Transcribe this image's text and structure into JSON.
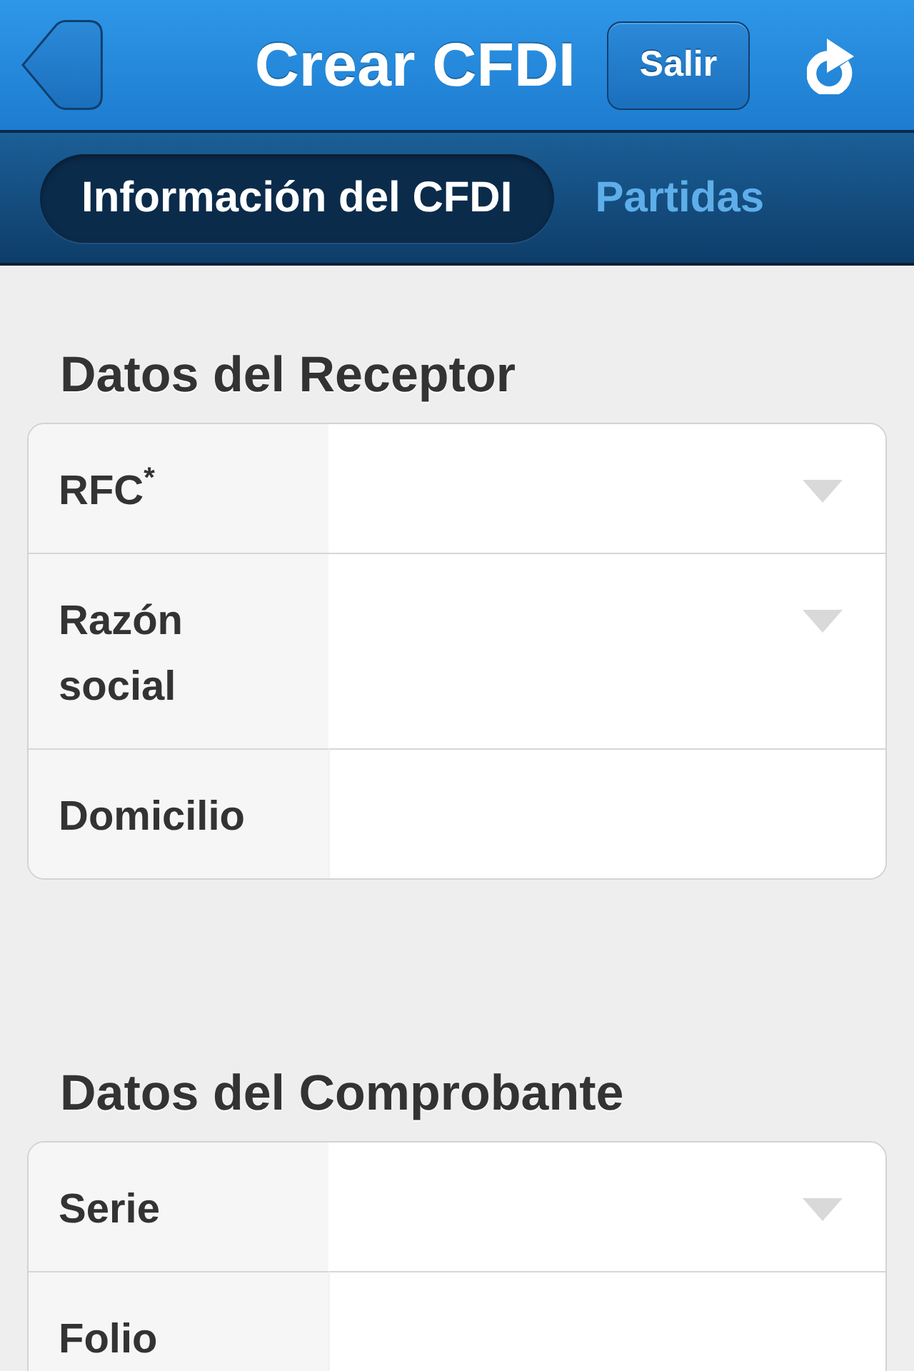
{
  "nav_bar": {
    "title": "Crear CFDI",
    "exit_button": "Salir"
  },
  "tabs": [
    {
      "label": "Información del CFDI",
      "selected": true
    },
    {
      "label": "Partidas",
      "selected": false
    }
  ],
  "sections": [
    {
      "title": "Datos del Receptor",
      "fields": [
        {
          "label": "RFC$^{*}$",
          "kind": "select"
        },
        {
          "label": "Razón social",
          "kind": "select"
        },
        {
          "label": "Domicilio",
          "kind": "text"
        }
      ]
    },
    {
      "title": "Datos del Comprobante",
      "fields": [
        {
          "label": "Serie",
          "kind": "select"
        },
        {
          "label": "Folio",
          "kind": "text"
        }
      ]
    }
  ]
}
